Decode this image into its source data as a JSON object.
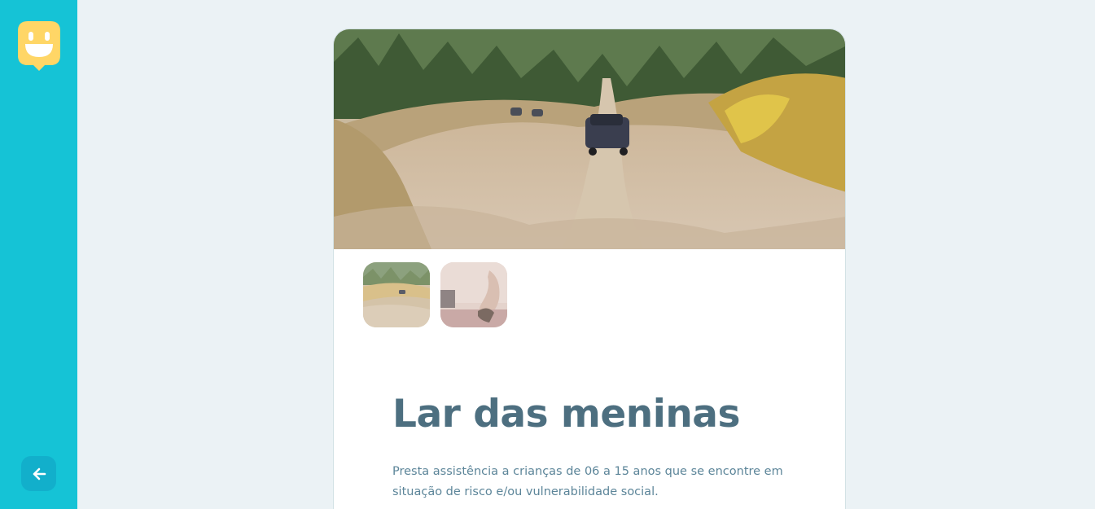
{
  "sidebar": {
    "logo_icon": "happy-map-marker-icon",
    "back_icon": "arrow-left-icon",
    "colors": {
      "background": "#15C3D6",
      "logo": "#FFD666",
      "back_button": "#12AFCB"
    }
  },
  "orphanage": {
    "name": "Lar das meninas",
    "about": "Presta assistência a crianças de 06 a 15 anos que se encontre em situação de risco e/ou vulnerabilidade social.",
    "images": [
      {
        "name": "dirt-road-jeep-photo"
      },
      {
        "name": "interior-room-photo"
      }
    ]
  },
  "colors": {
    "page_background": "#EBF2F5",
    "title": "#4D6F80",
    "text": "#5C8599"
  }
}
